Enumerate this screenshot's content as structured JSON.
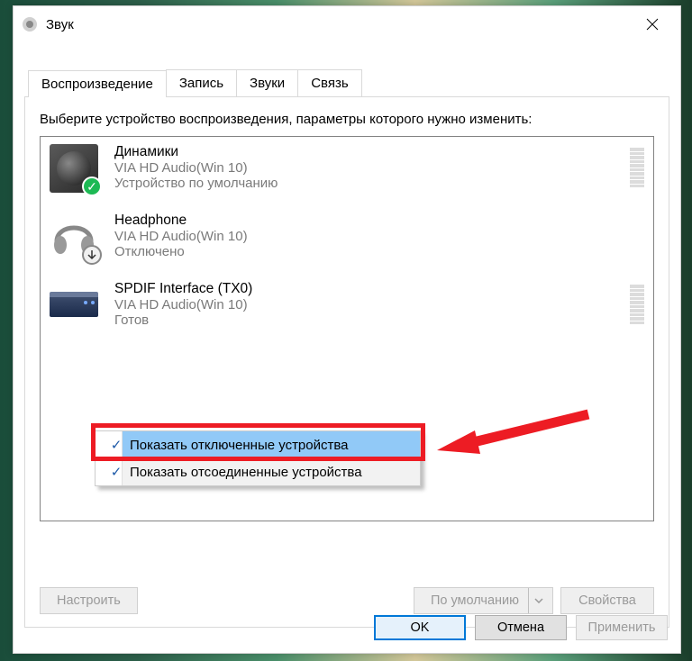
{
  "window": {
    "title": "Звук",
    "close_icon": "close"
  },
  "tabs": [
    {
      "label": "Воспроизведение",
      "active": true
    },
    {
      "label": "Запись",
      "active": false
    },
    {
      "label": "Звуки",
      "active": false
    },
    {
      "label": "Связь",
      "active": false
    }
  ],
  "instruction": "Выберите устройство воспроизведения, параметры которого нужно изменить:",
  "devices": [
    {
      "name": "Динамики",
      "subtitle": "VIA HD Audio(Win 10)",
      "status": "Устройство по умолчанию",
      "icon": "speaker",
      "badge": "check",
      "meter": true
    },
    {
      "name": "Headphone",
      "subtitle": "VIA HD Audio(Win 10)",
      "status": "Отключено",
      "icon": "headphone",
      "badge": "down",
      "meter": false
    },
    {
      "name": "SPDIF Interface (TX0)",
      "subtitle": "VIA HD Audio(Win 10)",
      "status": "Готов",
      "icon": "spdif",
      "badge": null,
      "meter": true
    }
  ],
  "context_menu": {
    "items": [
      {
        "label": "Показать отключенные устройства",
        "checked": true,
        "highlighted": true
      },
      {
        "label": "Показать отсоединенные устройства",
        "checked": true,
        "highlighted": false
      }
    ]
  },
  "bottom_buttons": {
    "configure": "Настроить",
    "default": "По умолчанию",
    "properties": "Свойства"
  },
  "dialog_buttons": {
    "ok": "OK",
    "cancel": "Отмена",
    "apply": "Применить"
  }
}
